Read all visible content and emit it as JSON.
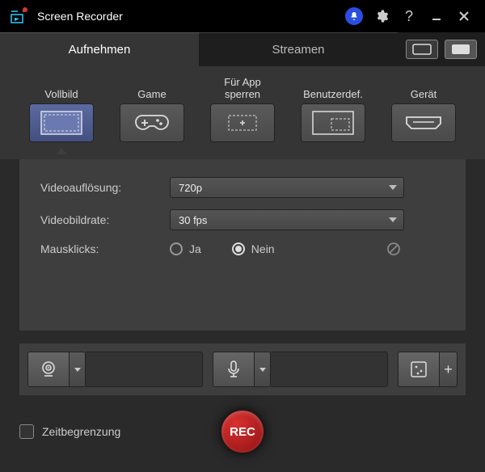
{
  "title": "Screen Recorder",
  "tabs": {
    "record": "Aufnehmen",
    "stream": "Streamen"
  },
  "modes": {
    "fullscreen": "Vollbild",
    "game": "Game",
    "lockapp": "Für App sperren",
    "custom": "Benutzerdef.",
    "device": "Gerät"
  },
  "settings": {
    "resolution_label": "Videoauflösung:",
    "resolution_value": "720p",
    "framerate_label": "Videobildrate:",
    "framerate_value": "30 fps",
    "clicks_label": "Mausklicks:",
    "clicks_yes": "Ja",
    "clicks_no": "Nein"
  },
  "bottom": {
    "timelimit": "Zeitbegrenzung",
    "rec": "REC"
  }
}
